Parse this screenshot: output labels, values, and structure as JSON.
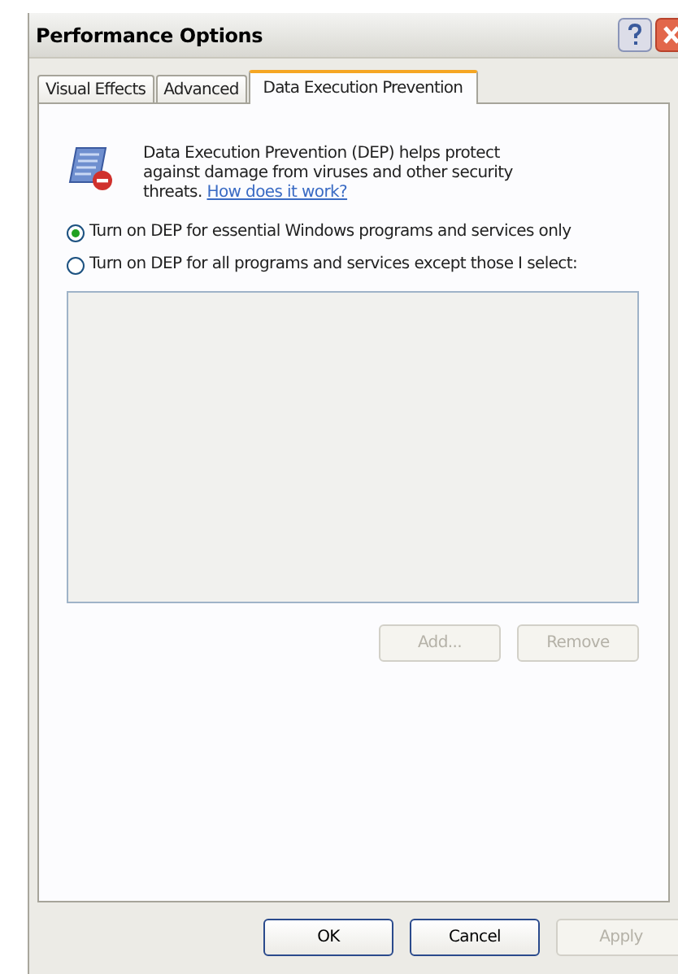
{
  "window": {
    "title": "Performance Options"
  },
  "tabs": [
    {
      "label": "Visual Effects",
      "selected": false
    },
    {
      "label": "Advanced",
      "selected": false
    },
    {
      "label": "Data Execution Prevention",
      "selected": true
    }
  ],
  "description": {
    "text": "Data Execution Prevention (DEP) helps protect against damage from viruses and other security threats.",
    "link": "How does it work?"
  },
  "options": [
    {
      "label": "Turn on DEP for essential Windows programs and services only",
      "selected": true
    },
    {
      "label": "Turn on DEP for all programs and services except those I select:",
      "selected": false
    }
  ],
  "list_buttons": [
    {
      "label": "Add...",
      "disabled": true
    },
    {
      "label": "Remove",
      "disabled": true
    }
  ],
  "dialog_buttons": [
    {
      "label": "OK",
      "disabled": false
    },
    {
      "label": "Cancel",
      "disabled": false
    },
    {
      "label": "Apply",
      "disabled": true
    }
  ]
}
